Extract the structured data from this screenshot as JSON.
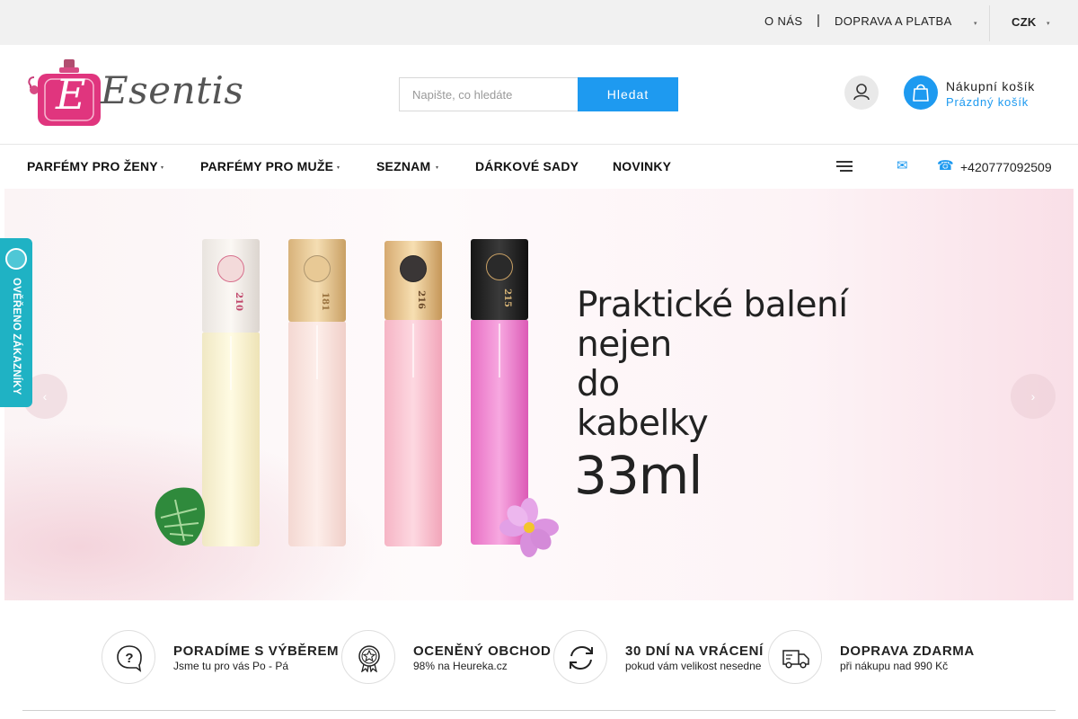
{
  "topbar": {
    "about": "O NÁS",
    "separator": "|",
    "shipping": "DOPRAVA A PLATBA",
    "currency": "CZK"
  },
  "header": {
    "logo_text": "Esentis",
    "logo_letter": "E",
    "search_placeholder": "Napište, co hledáte",
    "search_button": "Hledat",
    "cart_title": "Nákupní košík",
    "cart_status": "Prázdný košík"
  },
  "nav": {
    "items": [
      {
        "label": "PARFÉMY PRO ŽENY",
        "has_dropdown": true
      },
      {
        "label": "PARFÉMY PRO MUŽE",
        "has_dropdown": true
      },
      {
        "label": "SEZNAM",
        "has_dropdown": true
      },
      {
        "label": "DÁRKOVÉ SADY",
        "has_dropdown": false
      },
      {
        "label": "NOVINKY",
        "has_dropdown": false
      }
    ],
    "phone": "+420777092509"
  },
  "banner": {
    "headline_lines": [
      "Praktické balení",
      "nejen",
      "do",
      "kabelky"
    ],
    "size": "33ml",
    "bottle_numbers": [
      "210",
      "181",
      "216",
      "215"
    ]
  },
  "badge": {
    "text": "OVĚŘENO ZÁKAZNÍKY"
  },
  "features": [
    {
      "icon": "question-bubble-icon",
      "title": "PORADÍME S VÝBĚREM",
      "subtitle": "Jsme tu pro vás Po - Pá"
    },
    {
      "icon": "award-star-icon",
      "title": "OCENĚNÝ OBCHOD",
      "subtitle": "98% na Heureka.cz"
    },
    {
      "icon": "refresh-arrows-icon",
      "title": "30 DNÍ NA VRÁCENÍ",
      "subtitle": "pokud vám velikost nesedne"
    },
    {
      "icon": "delivery-truck-icon",
      "title": "DOPRAVA ZDARMA",
      "subtitle": "při nákupu nad 990 Kč"
    }
  ],
  "colors": {
    "accent": "#1e9af0",
    "badge": "#1fb2c4",
    "logo_pink": "#e0357e"
  }
}
